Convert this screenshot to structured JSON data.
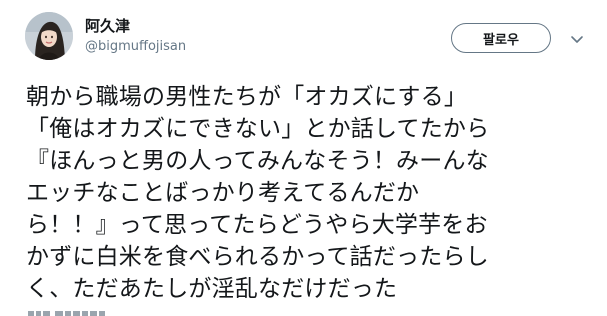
{
  "author": {
    "display_name": "阿久津",
    "handle": "@bigmuffojisan",
    "avatar_icon": "user-avatar-icon"
  },
  "actions": {
    "follow_label": "팔로우",
    "menu_icon": "chevron-down-icon"
  },
  "tweet": {
    "lines": [
      "朝から職場の男性たちが「オカズにする」",
      "「俺はオカズにできない」とか話してたから",
      "『ほんっと男の人ってみんなそう！みーんな",
      "エッチなことばっかり考えてるんだか",
      "ら！！』って思ってたらどうやら大学芋をお",
      "かずに白米を食べられるかって話だったらし",
      "く、ただあたしが淫乱なだけだった"
    ]
  },
  "colors": {
    "text": "#14171a",
    "secondary_text": "#657786",
    "button_border": "#657786"
  }
}
